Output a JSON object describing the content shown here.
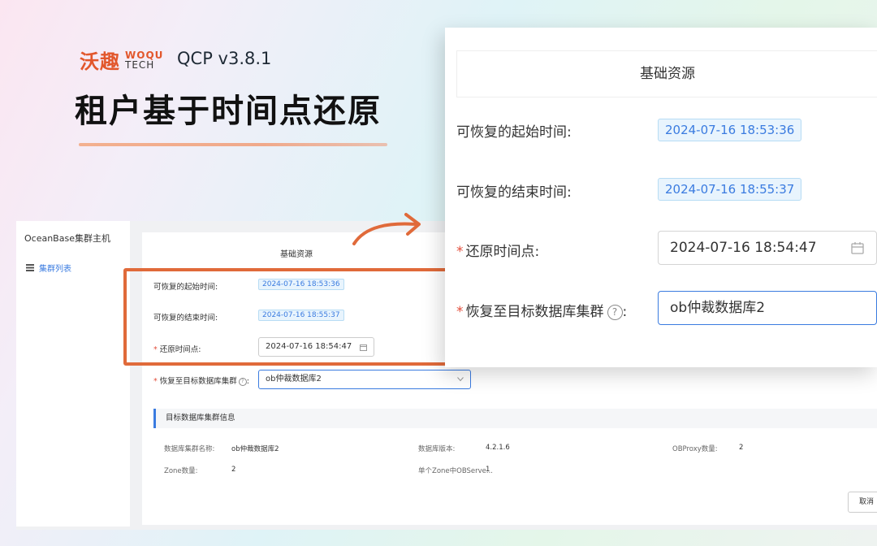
{
  "brand": {
    "logo_cn": "沃趣",
    "logo_en_top": "WOQU",
    "logo_en_bottom": "TECH",
    "version": "QCP v3.8.1"
  },
  "headline": "租户基于时间点还原",
  "sidebar": {
    "title": "OceanBase集群主机",
    "items": [
      {
        "label": "集群列表"
      }
    ]
  },
  "form": {
    "section_title": "基础资源",
    "start_time_label": "可恢复的起始时间:",
    "start_time_value": "2024-07-16 18:53:36",
    "end_time_label": "可恢复的结束时间:",
    "end_time_value": "2024-07-16 18:55:37",
    "restore_point_label": "还原时间点:",
    "restore_point_value": "2024-07-16 18:54:47",
    "target_cluster_label": "恢复至目标数据库集群",
    "target_cluster_colon": ":",
    "target_cluster_value": "ob仲裁数据库2",
    "required_mark": "*",
    "help_glyph": "?"
  },
  "cluster_info": {
    "title": "目标数据库集群信息",
    "fields": [
      {
        "label": "数据库集群名称:",
        "value": "ob仲裁数据库2"
      },
      {
        "label": "数据库版本:",
        "value": "4.2.1.6"
      },
      {
        "label": "OBProxy数量:",
        "value": "2"
      },
      {
        "label": "Zone数量:",
        "value": "2"
      },
      {
        "label": "单个Zone中OBServe...",
        "value": "1"
      }
    ]
  },
  "actions": {
    "cancel_label": "取消"
  },
  "colors": {
    "accent": "#3a7be0",
    "highlight": "#e06a3a",
    "required": "#e24d3b",
    "brand": "#e2572c"
  }
}
